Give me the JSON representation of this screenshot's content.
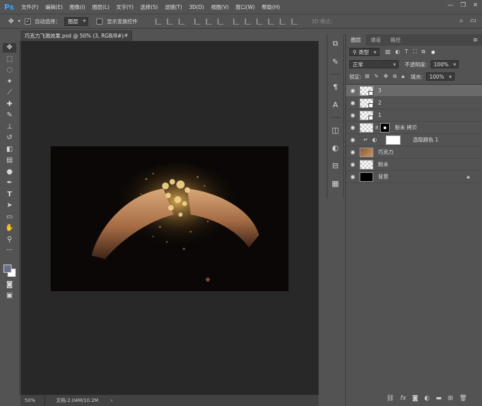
{
  "app": {
    "logo": "Ps"
  },
  "menu": [
    "文件(F)",
    "编辑(E)",
    "图像(I)",
    "图层(L)",
    "文字(Y)",
    "选择(S)",
    "滤镜(T)",
    "3D(D)",
    "视图(V)",
    "窗口(W)",
    "帮助(H)"
  ],
  "window_controls": {
    "minimize": "—",
    "restore": "❐",
    "close": "✕"
  },
  "options": {
    "auto_select_label": "自动选择：",
    "auto_select_checked": true,
    "auto_select_value": "图层",
    "show_transform_label": "显示变换控件",
    "show_transform_checked": false,
    "mode_3d_label": "3D 模式："
  },
  "document": {
    "tab_title": "巧克力飞溅效果.psd @ 50% (3, RGB/8#) *",
    "zoom": "50%",
    "doc_info": "文档:2.04M/10.2M"
  },
  "layers_panel": {
    "tabs": [
      "图层",
      "通道",
      "路径"
    ],
    "active_tab": "图层",
    "filter_kind": "类型",
    "blend_mode": "正常",
    "opacity_label": "不透明度:",
    "opacity_value": "100%",
    "lock_label": "锁定:",
    "fill_label": "填充:",
    "fill_value": "100%",
    "layers": [
      {
        "name": "3",
        "selected": true
      },
      {
        "name": "2",
        "selected": false
      },
      {
        "name": "1",
        "selected": false
      },
      {
        "name": "粉末 拷贝",
        "selected": false
      },
      {
        "name": "选取颜色 1",
        "selected": false
      },
      {
        "name": "巧克力",
        "selected": false
      },
      {
        "name": "粉末",
        "selected": false
      },
      {
        "name": "背景",
        "selected": false
      }
    ]
  },
  "colors": {
    "foreground": "#6a6c8a",
    "background": "#ffffff",
    "canvas_bg": "#282828",
    "ui_bg": "#535353",
    "accent_logo": "#31a8ff"
  }
}
